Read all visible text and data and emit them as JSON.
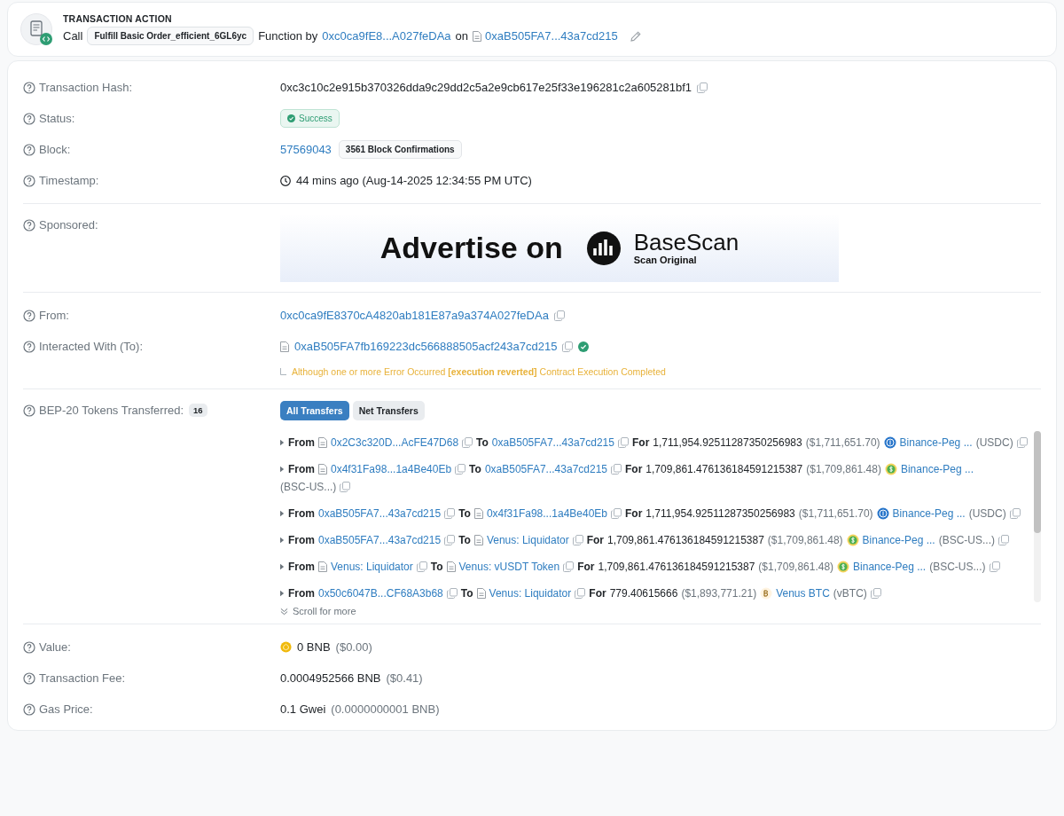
{
  "action": {
    "title": "TRANSACTION ACTION",
    "call": "Call",
    "function": "Fulfill Basic Order_efficient_6GL6yc",
    "by": "Function by",
    "from": "0xc0ca9fE8...A027feDAa",
    "on": "on",
    "to": "0xaB505FA7...43a7cd215"
  },
  "hash": {
    "label": "Transaction Hash:",
    "value": "0xc3c10c2e915b370326dda9c29dd2c5a2e9cb617e25f33e196281c2a605281bf1"
  },
  "status": {
    "label": "Status:",
    "value": "Success"
  },
  "block": {
    "label": "Block:",
    "number": "57569043",
    "confirmations": "3561 Block Confirmations"
  },
  "timestamp": {
    "label": "Timestamp:",
    "value": "44 mins ago (Aug-14-2025 12:34:55 PM UTC)"
  },
  "sponsored": {
    "label": "Sponsored:",
    "headline": "Advertise on",
    "brand": "BaseScan",
    "tagline": "Scan Original"
  },
  "from": {
    "label": "From:",
    "address": "0xc0ca9fE8370cA4820ab181E87a9a374A027feDAa"
  },
  "interacted": {
    "label": "Interacted With (To):",
    "address": "0xaB505FA7fb169223dc566888505acf243a7cd215",
    "verified": true,
    "note": "Although one or more Error Occurred **[execution reverted]** Contract Execution Completed"
  },
  "tokens": {
    "label": "BEP-20 Tokens Transferred:",
    "count": "16",
    "tabs": [
      {
        "label": "All Transfers",
        "selected": true
      },
      {
        "label": "Net Transfers",
        "selected": false
      }
    ],
    "transfers": [
      {
        "from_label": "From",
        "from": {
          "text": "0x2C3c320D...AcFE47D68",
          "contract": true
        },
        "to_label": "To",
        "to": {
          "text": "0xaB505FA7...43a7cd215",
          "contract": false
        },
        "for_label": "For",
        "amount": "1,711,954.92511287350256983",
        "usd": "($1,711,651.70)",
        "token": {
          "kind": "usdc",
          "name": "Binance-Peg ...",
          "symbol": "(USDC)"
        }
      },
      {
        "from_label": "From",
        "from": {
          "text": "0x4f31Fa98...1a4Be40Eb",
          "contract": true
        },
        "to_label": "To",
        "to": {
          "text": "0xaB505FA7...43a7cd215",
          "contract": false
        },
        "for_label": "For",
        "amount": "1,709,861.476136184591215387",
        "usd": "($1,709,861.48)",
        "token": {
          "kind": "usdt",
          "name": "Binance-Peg ...",
          "symbol": "(BSC-US...)"
        }
      },
      {
        "from_label": "From",
        "from": {
          "text": "0xaB505FA7...43a7cd215",
          "contract": false
        },
        "to_label": "To",
        "to": {
          "text": "0x4f31Fa98...1a4Be40Eb",
          "contract": true
        },
        "for_label": "For",
        "amount": "1,711,954.92511287350256983",
        "usd": "($1,711,651.70)",
        "token": {
          "kind": "usdc",
          "name": "Binance-Peg ...",
          "symbol": "(USDC)"
        }
      },
      {
        "from_label": "From",
        "from": {
          "text": "0xaB505FA7...43a7cd215",
          "contract": false
        },
        "to_label": "To",
        "to": {
          "text": "Venus: Liquidator",
          "contract": true
        },
        "for_label": "For",
        "amount": "1,709,861.476136184591215387",
        "usd": "($1,709,861.48)",
        "token": {
          "kind": "usdt",
          "name": "Binance-Peg ...",
          "symbol": "(BSC-US...)"
        }
      },
      {
        "from_label": "From",
        "from": {
          "text": "Venus: Liquidator",
          "contract": true
        },
        "to_label": "To",
        "to": {
          "text": "Venus: vUSDT Token",
          "contract": true
        },
        "for_label": "For",
        "amount": "1,709,861.476136184591215387",
        "usd": "($1,709,861.48)",
        "token": {
          "kind": "usdt",
          "name": "Binance-Peg ...",
          "symbol": "(BSC-US...)"
        }
      },
      {
        "from_label": "From",
        "from": {
          "text": "0x50c6047B...CF68A3b68",
          "contract": false
        },
        "to_label": "To",
        "to": {
          "text": "Venus: Liquidator",
          "contract": true
        },
        "for_label": "For",
        "amount": "779.40615666",
        "usd": "($1,893,771.21)",
        "token": {
          "kind": "btc",
          "name": "Venus BTC",
          "symbol": "(vBTC)"
        }
      }
    ],
    "more": "Scroll for more"
  },
  "value": {
    "label": "Value:",
    "amount": "0 BNB",
    "usd": "($0.00)"
  },
  "fee": {
    "label": "Transaction Fee:",
    "amount": "0.0004952566 BNB",
    "usd": "($0.41)"
  },
  "gas": {
    "label": "Gas Price:",
    "amount": "0.1 Gwei",
    "usd": "(0.0000000001 BNB)"
  }
}
